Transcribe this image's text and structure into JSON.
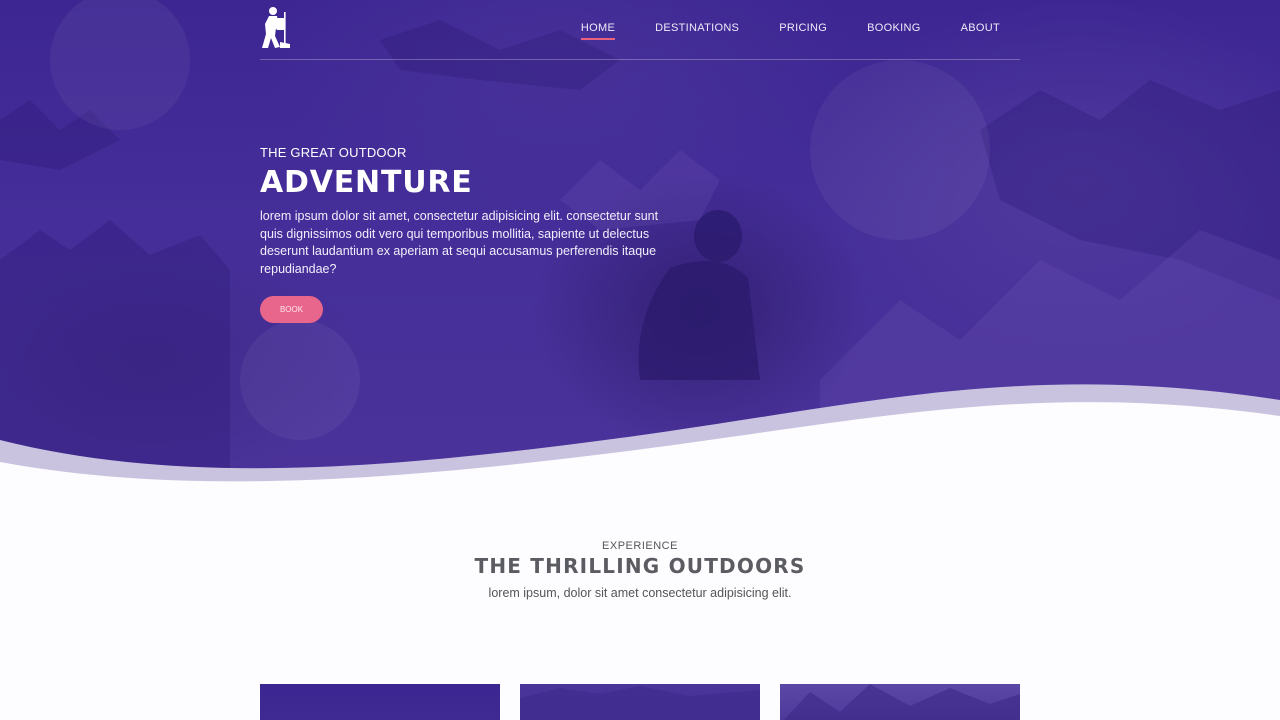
{
  "nav": {
    "items": [
      {
        "label": "HOME",
        "active": true
      },
      {
        "label": "DESTINATIONS",
        "active": false
      },
      {
        "label": "PRICING",
        "active": false
      },
      {
        "label": "BOOKING",
        "active": false
      },
      {
        "label": "ABOUT",
        "active": false
      }
    ],
    "logo_icon": "hiker-icon"
  },
  "hero": {
    "eyebrow": "THE GREAT OUTDOOR",
    "title": "ADVENTURE",
    "text": "lorem ipsum dolor sit amet, consectetur adipisicing elit. consectetur sunt quis dignissimos odit vero qui temporibus mollitia, sapiente ut delectus deserunt laudantium ex aperiam at sequi accusamus perferendis itaque repudiandae?",
    "button_label": "BOOK"
  },
  "section": {
    "eyebrow": "EXPERIENCE",
    "title": "THE THRILLING OUTDOORS",
    "text": "lorem ipsum, dolor sit amet consectetur adipisicing elit."
  },
  "colors": {
    "hero_purple": "#452e99",
    "accent_pink": "#e8658b",
    "nav_underline": "#e8617f",
    "wave_lavender": "#c9c3e0",
    "heading_gray": "#5b5b62"
  }
}
